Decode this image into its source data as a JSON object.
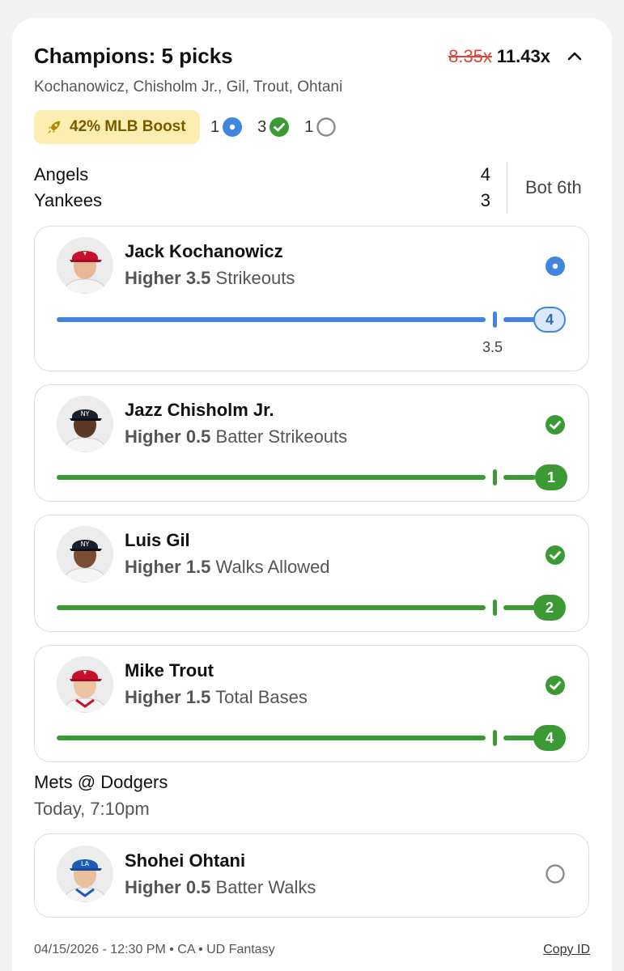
{
  "header": {
    "title": "Champions: 5 picks",
    "old_multiplier": "8.35x",
    "new_multiplier": "11.43x",
    "players_line": "Kochanowicz, Chisholm Jr., Gil, Trout, Ohtani"
  },
  "boost": {
    "label": "42% MLB Boost",
    "icon": "rocket-icon",
    "color": "#fbeeb0"
  },
  "counts": {
    "live": "1",
    "won": "3",
    "pending": "1"
  },
  "game1": {
    "team1": "Angels",
    "score1": "4",
    "team2": "Yankees",
    "score2": "3",
    "inning": "Bot 6th"
  },
  "picks": [
    {
      "name": "Jack Kochanowicz",
      "direction": "Higher",
      "line": "3.5",
      "stat": "Strikeouts",
      "current": "4",
      "status": "live",
      "line_label": "3.5",
      "cap": "angels"
    },
    {
      "name": "Jazz Chisholm Jr.",
      "direction": "Higher",
      "line": "0.5",
      "stat": "Batter Strikeouts",
      "current": "1",
      "status": "won",
      "cap": "yankees"
    },
    {
      "name": "Luis Gil",
      "direction": "Higher",
      "line": "1.5",
      "stat": "Walks Allowed",
      "current": "2",
      "status": "won",
      "cap": "yankees"
    },
    {
      "name": "Mike Trout",
      "direction": "Higher",
      "line": "1.5",
      "stat": "Total Bases",
      "current": "4",
      "status": "won",
      "cap": "angels"
    },
    {
      "name": "Shohei Ohtani",
      "direction": "Higher",
      "line": "0.5",
      "stat": "Batter Walks",
      "status": "pending",
      "cap": "dodgers"
    }
  ],
  "game2": {
    "matchup": "Mets @ Dodgers",
    "time": "Today, 7:10pm"
  },
  "footer": {
    "meta": "04/15/2026 - 12:30 PM • CA • UD Fantasy",
    "copy_label": "Copy ID"
  },
  "colors": {
    "live": "#3f86dc",
    "won": "#3c9a35",
    "strike": "#e0433b"
  }
}
